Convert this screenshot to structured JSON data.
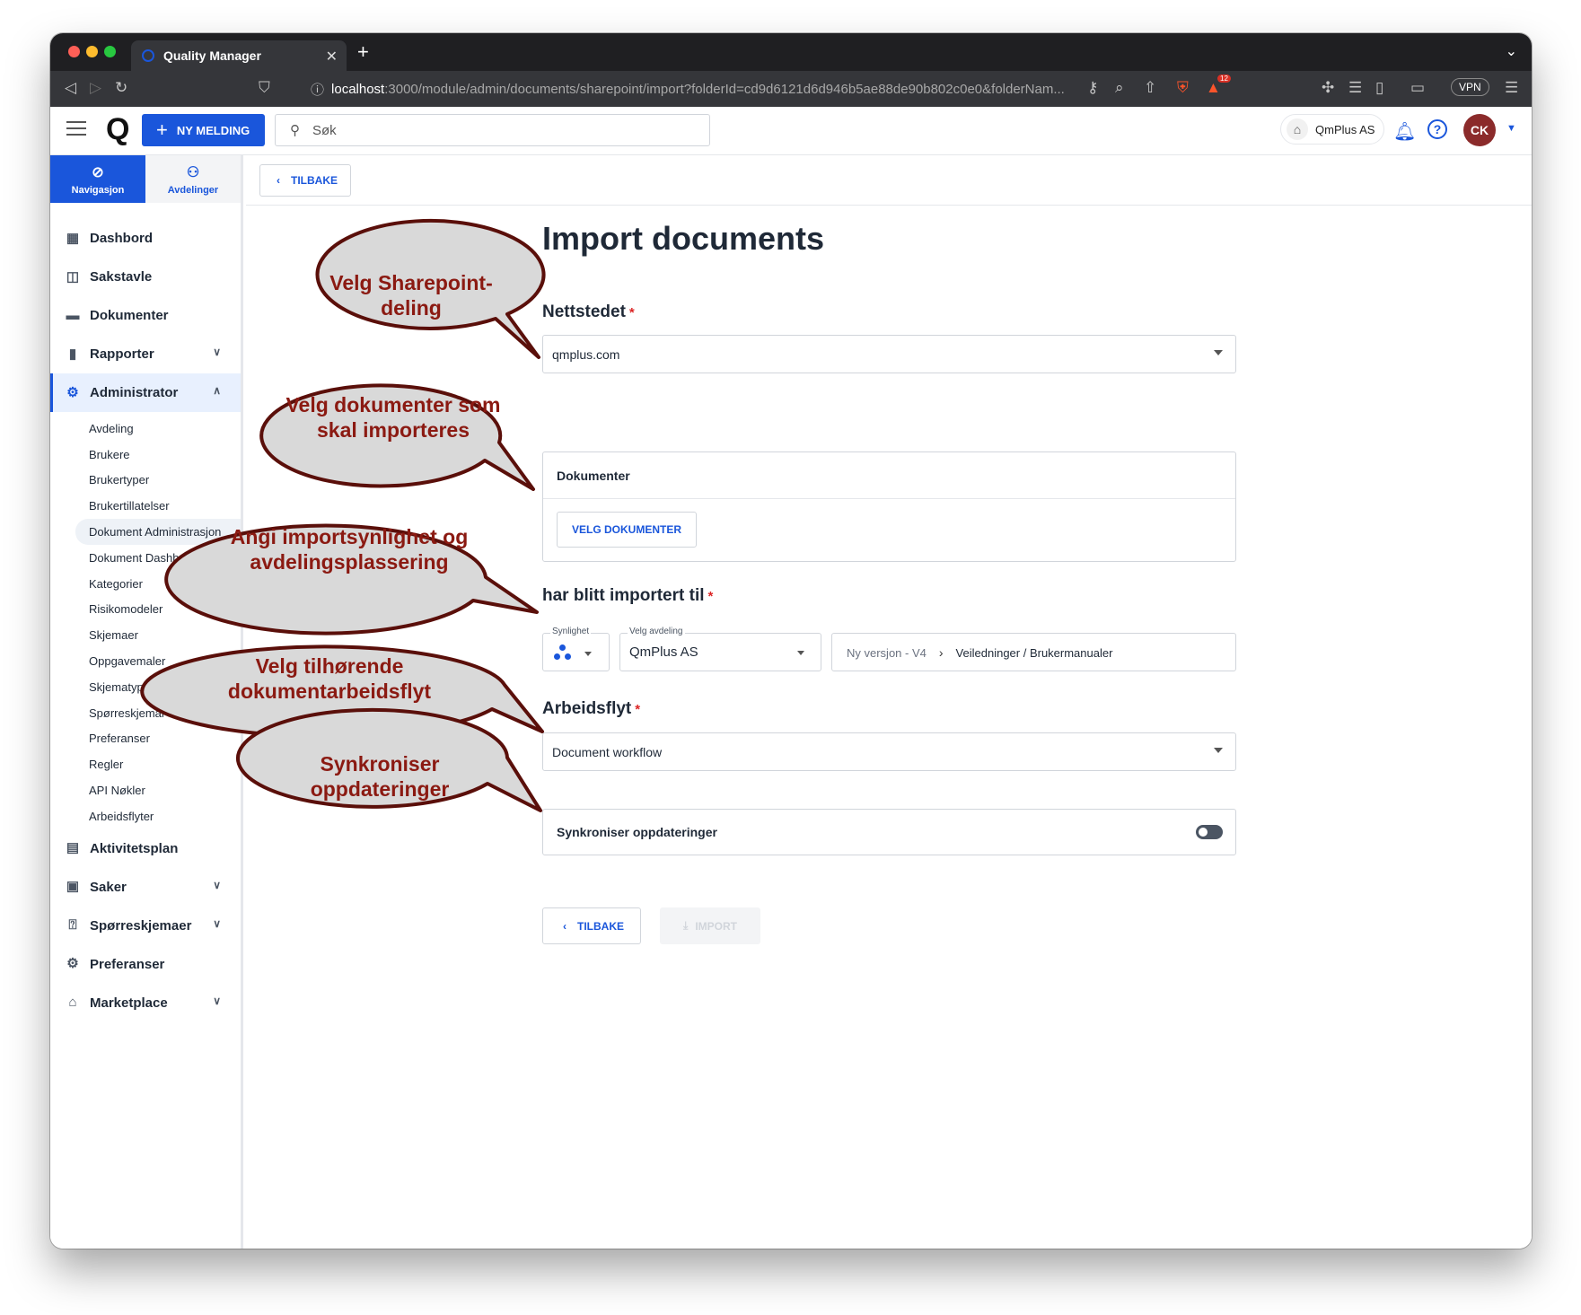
{
  "browser": {
    "tab_title": "Quality Manager",
    "url_host": "localhost",
    "url_path": ":3000/module/admin/documents/sharepoint/import?folderId=cd9d6121d6d946b5ae88de90b802c0e0&folderNam...",
    "extension_badge": "12",
    "vpn_label": "VPN"
  },
  "header": {
    "new_message_label": "NY MELDING",
    "search_placeholder": "Søk",
    "company_label": "QmPlus AS",
    "avatar_initials": "CK",
    "accent_color": "#1a56db"
  },
  "sidebar": {
    "tabs": [
      {
        "label": "Navigasjon",
        "icon": "compass-icon"
      },
      {
        "label": "Avdelinger",
        "icon": "org-chart-icon"
      }
    ],
    "items_top": [
      {
        "label": "Dashbord",
        "icon": "dashboard-icon"
      },
      {
        "label": "Sakstavle",
        "icon": "board-icon"
      },
      {
        "label": "Dokumenter",
        "icon": "folder-icon"
      },
      {
        "label": "Rapporter",
        "icon": "bar-chart-icon"
      },
      {
        "label": "Administrator",
        "icon": "admin-gear-icon"
      }
    ],
    "admin_subitems": [
      "Avdeling",
      "Brukere",
      "Brukertyper",
      "Brukertillatelser",
      "Dokument Administrasjon",
      "Dokument Dashbord",
      "Kategorier",
      "Risikomodeler",
      "Skjemaer",
      "Oppgavemaler",
      "Skjematyper",
      "Spørreskjemar",
      "Preferanser",
      "Regler",
      "API Nøkler",
      "Arbeidsflyter"
    ],
    "items_bottom": [
      {
        "label": "Aktivitetsplan",
        "icon": "calendar-icon"
      },
      {
        "label": "Saker",
        "icon": "cases-icon"
      },
      {
        "label": "Spørreskjemaer",
        "icon": "questionnaire-icon"
      },
      {
        "label": "Preferanser",
        "icon": "settings-icon"
      },
      {
        "label": "Marketplace",
        "icon": "store-icon"
      }
    ]
  },
  "main": {
    "back_label": "TILBAKE",
    "title": "Import documents",
    "site_label": "Nettstedet",
    "site_value": "qmplus.com",
    "documents_card_title": "Dokumenter",
    "choose_documents_label": "VELG DOKUMENTER",
    "imported_to_label": "har blitt importert til",
    "visibility_legend": "Synlighet",
    "department_legend": "Velg avdeling",
    "department_value": "QmPlus AS",
    "breadcrumb_version": "Ny versjon - V4",
    "breadcrumb_path": "Veiledninger / Brukermanualer",
    "workflow_label": "Arbeidsflyt",
    "workflow_value": "Document workflow",
    "sync_label": "Synkroniser oppdateringer",
    "bottom_back_label": "TILBAKE",
    "import_label": "IMPORT",
    "required_mark": "*"
  },
  "annotations": [
    "Velg Sharepoint-deling",
    "Velg dokumenter som skal importeres",
    "Angi importsynlighet og avdelingsplassering",
    "Velg tilhørende dokumentarbeidsflyt",
    "Synkroniser oppdateringer"
  ]
}
